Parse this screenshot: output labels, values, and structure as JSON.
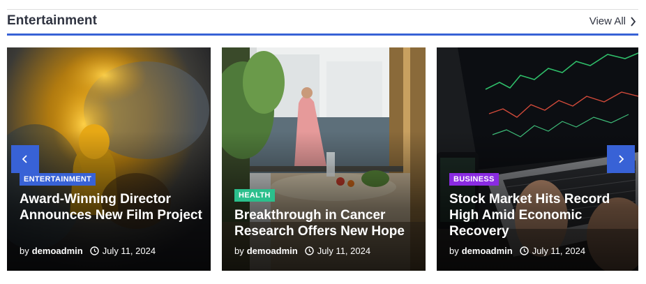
{
  "section": {
    "title": "Entertainment",
    "view_all_label": "View All"
  },
  "colors": {
    "accent": "#3862d6",
    "badge_entertainment": "#3862d6",
    "badge_health": "#2bbf8c",
    "badge_business": "#8a2be2"
  },
  "cards": [
    {
      "category": "ENTERTAINMENT",
      "title": "Award-Winning Director Announces New Film Project",
      "by": "by",
      "author": "demoadmin",
      "date": "July 11, 2024"
    },
    {
      "category": "HEALTH",
      "title": "Breakthrough in Cancer Research Offers New Hope",
      "by": "by",
      "author": "demoadmin",
      "date": "July 11, 2024"
    },
    {
      "category": "BUSINESS",
      "title": "Stock Market Hits Record High Amid Economic Recovery",
      "by": "by",
      "author": "demoadmin",
      "date": "July 11, 2024"
    }
  ],
  "slider": {
    "prev_icon": "chevron-left-icon",
    "next_icon": "chevron-right-icon"
  }
}
